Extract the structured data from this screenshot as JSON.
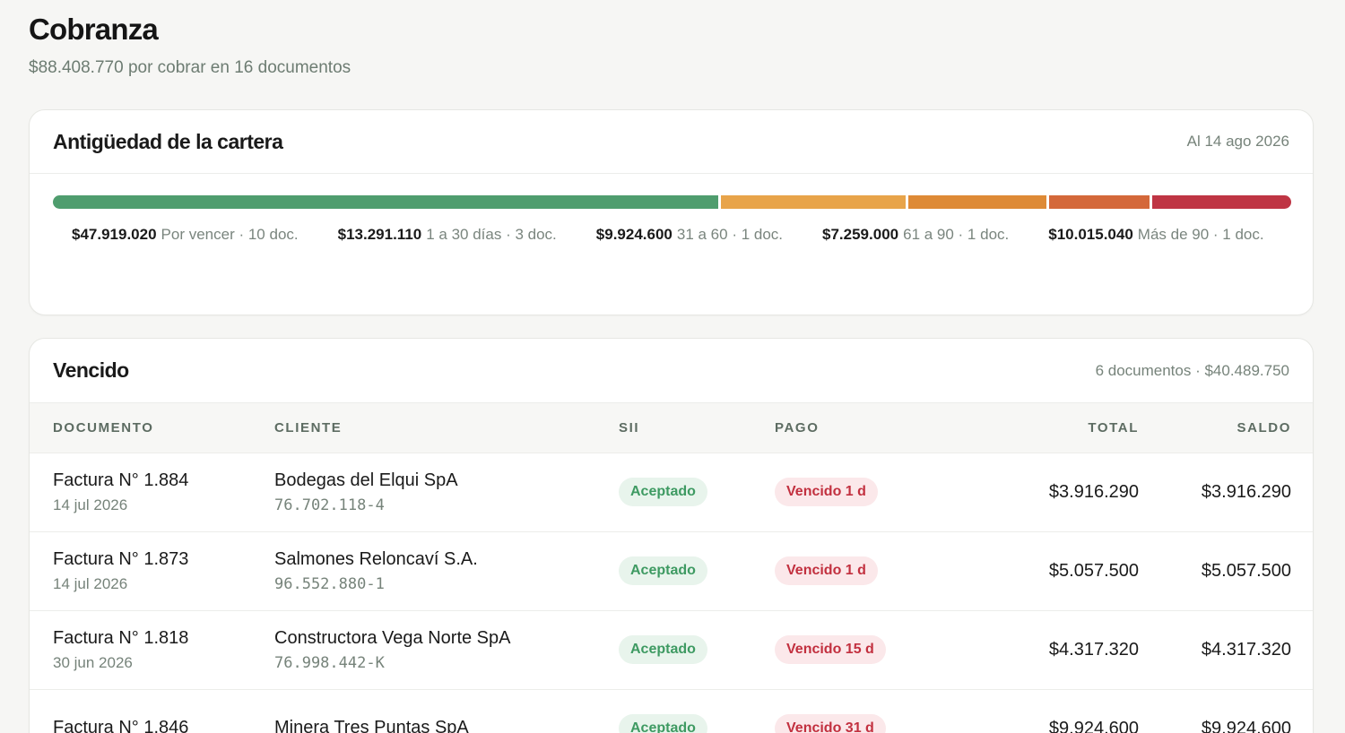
{
  "page": {
    "title": "Cobranza",
    "subtitle": "$88.408.770 por cobrar en 16 documentos"
  },
  "aging": {
    "title": "Antigüedad de la cartera",
    "as_of": "Al 14 ago 2026",
    "buckets": [
      {
        "amount": "$47.919.020",
        "label": "Por vencer · 10 doc.",
        "value": 47919020,
        "color": "#4f9d6e"
      },
      {
        "amount": "$13.291.110",
        "label": "1 a 30 días · 3 doc.",
        "value": 13291110,
        "color": "#e8a44a"
      },
      {
        "amount": "$9.924.600",
        "label": "31 a 60 · 1 doc.",
        "value": 9924600,
        "color": "#de8a36"
      },
      {
        "amount": "$7.259.000",
        "label": "61 a 90 · 1 doc.",
        "value": 7259000,
        "color": "#d4683a"
      },
      {
        "amount": "$10.015.040",
        "label": "Más de 90 · 1 doc.",
        "value": 10015040,
        "color": "#bf3544"
      }
    ]
  },
  "overdue": {
    "title": "Vencido",
    "summary": "6 documentos · $40.489.750",
    "columns": {
      "document": "DOCUMENTO",
      "client": "CLIENTE",
      "sii": "SII",
      "payment": "PAGO",
      "total": "TOTAL",
      "balance": "SALDO"
    },
    "rows": [
      {
        "doc": "Factura N° 1.884",
        "date": "14 jul 2026",
        "client": "Bodegas del Elqui SpA",
        "rut": "76.702.118-4",
        "sii": "Aceptado",
        "payment": "Vencido 1 d",
        "total": "$3.916.290",
        "balance": "$3.916.290"
      },
      {
        "doc": "Factura N° 1.873",
        "date": "14 jul 2026",
        "client": "Salmones Reloncaví S.A.",
        "rut": "96.552.880-1",
        "sii": "Aceptado",
        "payment": "Vencido 1 d",
        "total": "$5.057.500",
        "balance": "$5.057.500"
      },
      {
        "doc": "Factura N° 1.818",
        "date": "30 jun 2026",
        "client": "Constructora Vega Norte SpA",
        "rut": "76.998.442-K",
        "sii": "Aceptado",
        "payment": "Vencido 15 d",
        "total": "$4.317.320",
        "balance": "$4.317.320"
      },
      {
        "doc": "Factura N° 1.846",
        "date": "",
        "client": "Minera Tres Puntas SpA",
        "rut": "",
        "sii": "Aceptado",
        "payment": "Vencido 31 d",
        "total": "$9.924.600",
        "balance": "$9.924.600"
      }
    ]
  }
}
